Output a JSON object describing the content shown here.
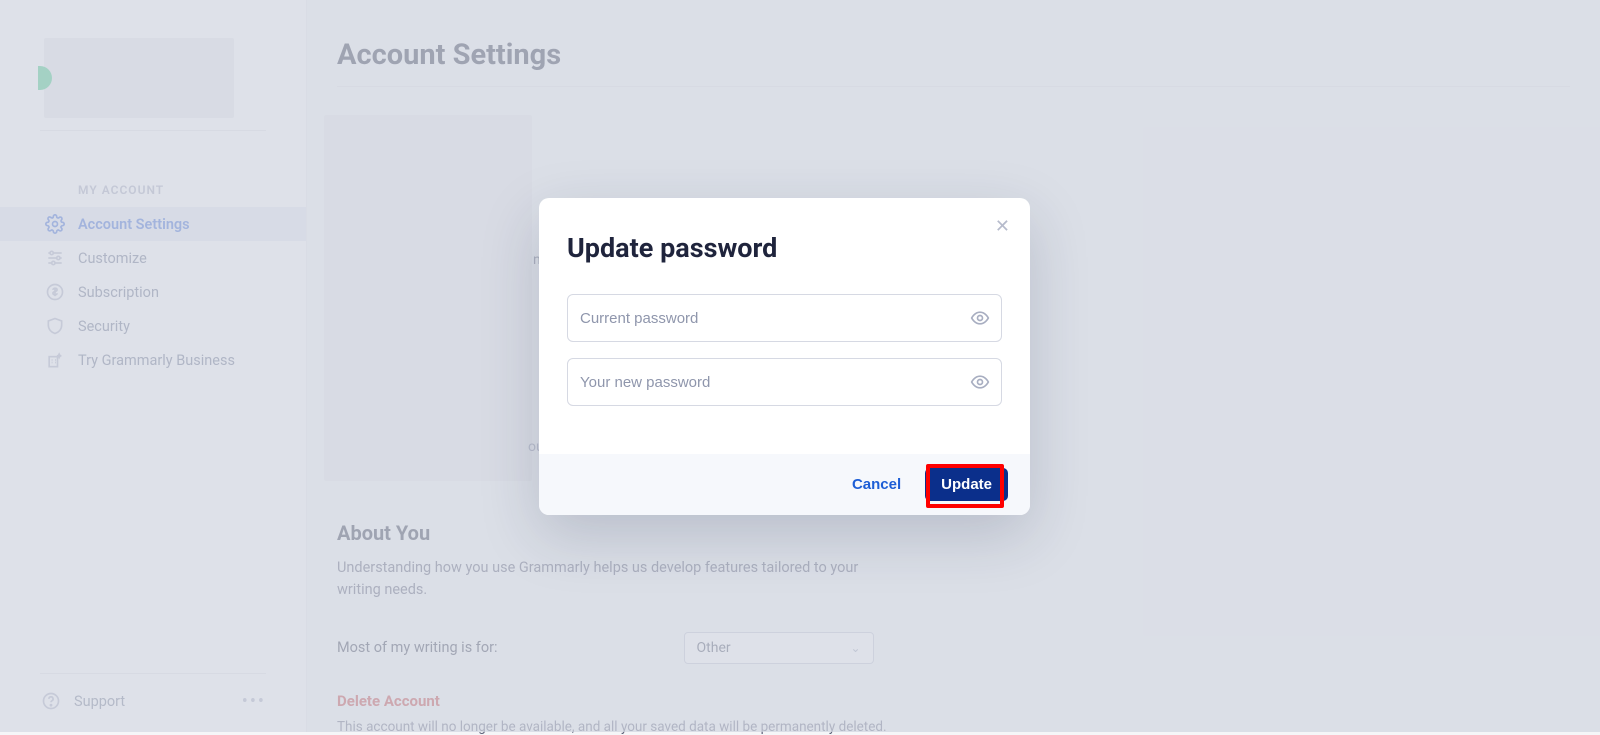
{
  "sidebar": {
    "section_label": "MY ACCOUNT",
    "items": [
      {
        "label": "Account Settings"
      },
      {
        "label": "Customize"
      },
      {
        "label": "Subscription"
      },
      {
        "label": "Security"
      },
      {
        "label": "Try Grammarly Business"
      }
    ],
    "support_label": "Support"
  },
  "page": {
    "title": "Account Settings",
    "stray_n": "n",
    "stray_ou": "ou",
    "about": {
      "heading": "About You",
      "description": "Understanding how you use Grammarly helps us develop features tailored to your writing needs.",
      "writing_label": "Most of my writing is for:",
      "writing_value": "Other"
    },
    "delete": {
      "heading": "Delete Account",
      "description": "This account will no longer be available, and all your saved data will be permanently deleted."
    }
  },
  "modal": {
    "title": "Update password",
    "current_placeholder": "Current password",
    "new_placeholder": "Your new password",
    "cancel_label": "Cancel",
    "update_label": "Update"
  }
}
